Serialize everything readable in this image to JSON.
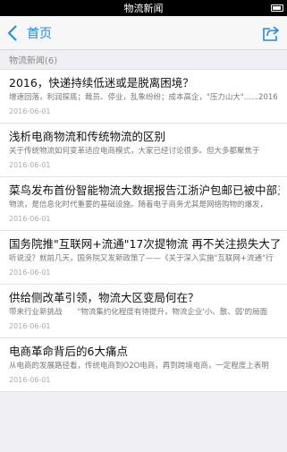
{
  "statusbar": {
    "title": "物流新闻"
  },
  "navbar": {
    "back_label": "首页"
  },
  "list": {
    "header": "物流新闻(6)",
    "items": [
      {
        "title": "2016，快递持续低迷或是脱离困境？",
        "summary": "增速回落，利润探底；裁员、停业，乱象纷纷；成本高企，\"压力山大\"......2016",
        "date": "2016-06-01"
      },
      {
        "title": "浅析电商物流和传统物流的区别",
        "summary": "关于传统物流如何变革适应电商模式，大家已经讨论很多。但大多都聚焦于",
        "date": "2016-06-01"
      },
      {
        "title": "菜鸟发布首份智能物流大数据报告江浙沪包邮已被中部五省超越",
        "summary": "物流，是信息化时代重要的基础设施。随着电子商务尤其是网络购物的爆发，",
        "date": "2016-06-01"
      },
      {
        "title": "国务院推\"互联网+流通\"17次提物流 再不关注损失大了",
        "summary": "听说没？就前几天，国务院又发新政策了——《关于深入实施\"互联网+流通\"行",
        "date": "2016-06-01"
      },
      {
        "title": "供给侧改革引领，物流大区变局何在？",
        "summary": "带来行业新挑战　　\"物流集约化程度有待提升，物流企业'小、散、弱'的局面",
        "date": "2016-06-01"
      },
      {
        "title": "电商革命背后的6大痛点",
        "summary": "从电商的发展路径看，传统电商到O2O电商，再到跨境电商，一定程度上表明",
        "date": "2016-06-01"
      }
    ]
  },
  "colors": {
    "accent": "#1a8ee6"
  }
}
